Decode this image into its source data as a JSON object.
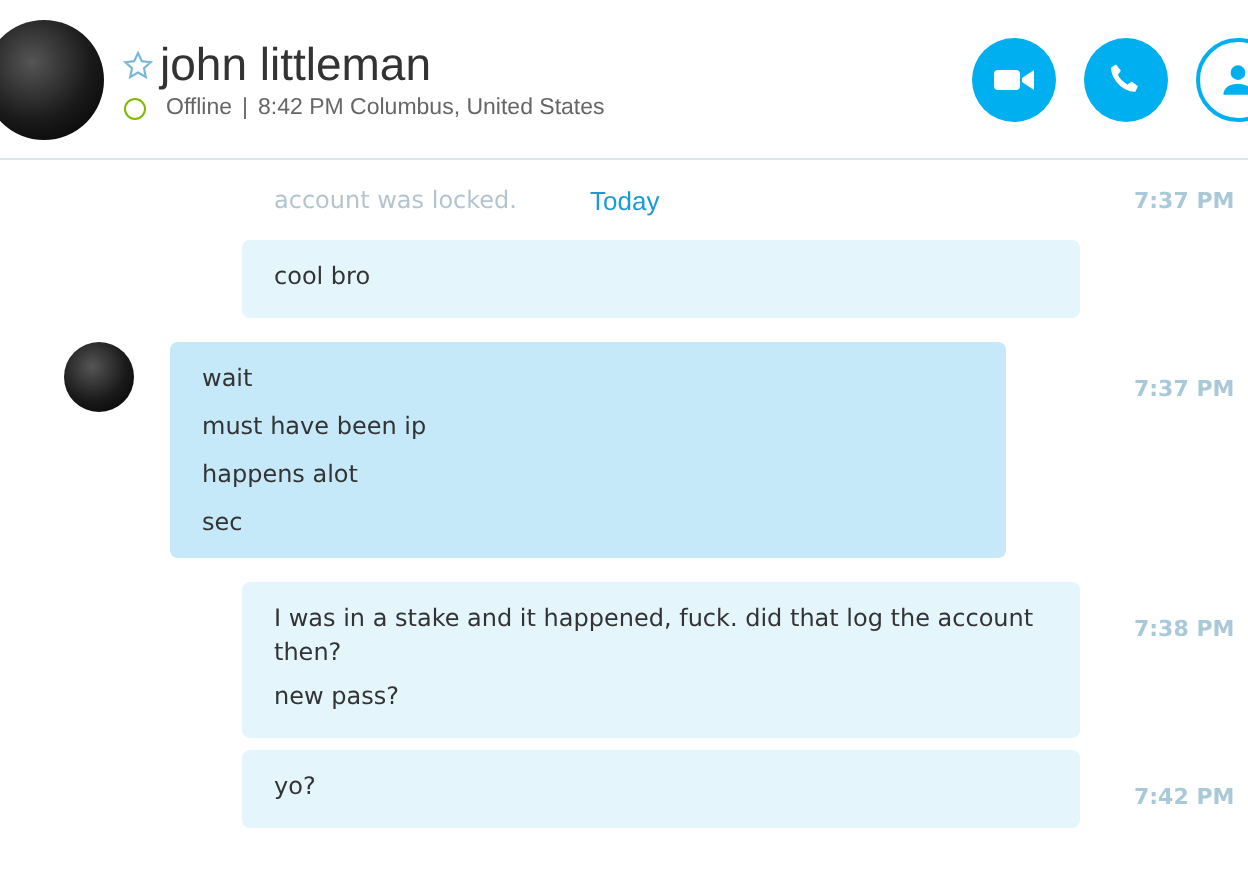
{
  "header": {
    "name": "john littleman",
    "favorite": false,
    "status_text": "Offline",
    "separator": "|",
    "local_time": "8:42 PM Columbus, United States"
  },
  "call_buttons": [
    {
      "kind": "video"
    },
    {
      "kind": "call"
    },
    {
      "kind": "profile"
    }
  ],
  "day_divider": {
    "label": "Today",
    "faded_text": "account was locked.",
    "faded_time": "7:37 PM"
  },
  "messages": [
    {
      "kind": "outgoing",
      "lines": [
        "cool bro"
      ]
    },
    {
      "kind": "incoming",
      "lines": [
        "wait",
        "must have been ip",
        "happens alot",
        "sec"
      ],
      "time": "7:37 PM"
    },
    {
      "kind": "outgoing",
      "lines": [
        "I was in a stake and it happened, fuck. did that log the account then?",
        "new pass?"
      ],
      "time": "7:38 PM"
    },
    {
      "kind": "outgoing",
      "lines": [
        "yo?"
      ],
      "time": "7:42 PM"
    }
  ]
}
